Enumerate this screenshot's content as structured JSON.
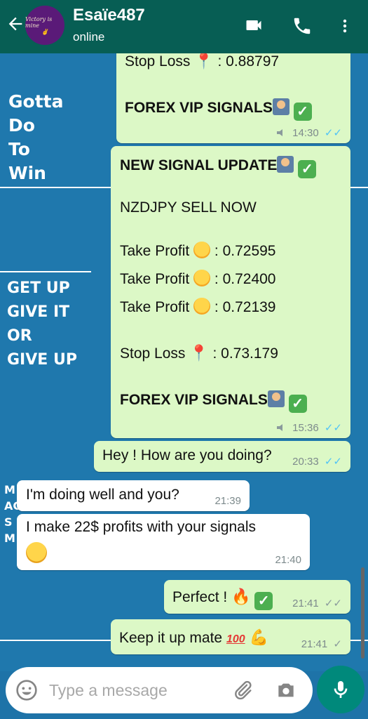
{
  "header": {
    "back_icon": "arrow-left-icon",
    "avatar_text_line1": "Victory is mine",
    "avatar_text_line2": "✌",
    "contact_name": "Esaïe487",
    "status": "online",
    "video_icon": "video-call-icon",
    "call_icon": "phone-icon",
    "menu_icon": "more-vert-icon"
  },
  "wallpaper": {
    "text1": [
      "Gotta",
      "Do",
      "To",
      "Win"
    ],
    "text2": [
      "GET UP",
      "GIVE IT",
      "OR",
      "GIVE UP"
    ],
    "text3": [
      "M",
      "AC",
      "S",
      "M"
    ]
  },
  "messages": [
    {
      "id": "msg1",
      "direction": "outgoing",
      "lines": [
        "Stop Loss",
        ": 0.88797",
        "FOREX VIP SIGNALS"
      ],
      "time": "14:30",
      "status": "read"
    },
    {
      "id": "msg2",
      "direction": "outgoing",
      "lines": [
        "NEW SIGNAL UPDATE",
        "NZDJPY SELL NOW",
        "Take Profit",
        ": 0.72595",
        "Take Profit",
        ": 0.72400",
        "Take Profit",
        ": 0.72139",
        "Stop Loss",
        ": 0.73.179",
        "FOREX VIP SIGNALS"
      ],
      "time": "15:36",
      "status": "read"
    },
    {
      "id": "msg3",
      "direction": "outgoing",
      "text": "Hey ! How are you doing?",
      "time": "20:33",
      "status": "read"
    },
    {
      "id": "msg4",
      "direction": "incoming",
      "text": "I'm  doing well and you?",
      "time": "21:39"
    },
    {
      "id": "msg5",
      "direction": "incoming",
      "text": "I make 22$ profits   with your signals",
      "time": "21:40"
    },
    {
      "id": "msg6",
      "direction": "outgoing",
      "text": "Perfect !",
      "time": "21:41",
      "status": "delivered"
    },
    {
      "id": "msg7",
      "direction": "outgoing",
      "text": "Keep it up mate",
      "time": "21:41",
      "status": "sent"
    }
  ],
  "input": {
    "placeholder": "Type a message",
    "emoji_icon": "emoji-icon",
    "attach_icon": "paperclip-icon",
    "camera_icon": "camera-icon",
    "mic_icon": "microphone-icon"
  },
  "colors": {
    "header": "#075e54",
    "outgoing_bubble": "#dcf8c6",
    "incoming_bubble": "#ffffff",
    "read_tick": "#4fc3f7",
    "mic_button": "#00897b"
  }
}
